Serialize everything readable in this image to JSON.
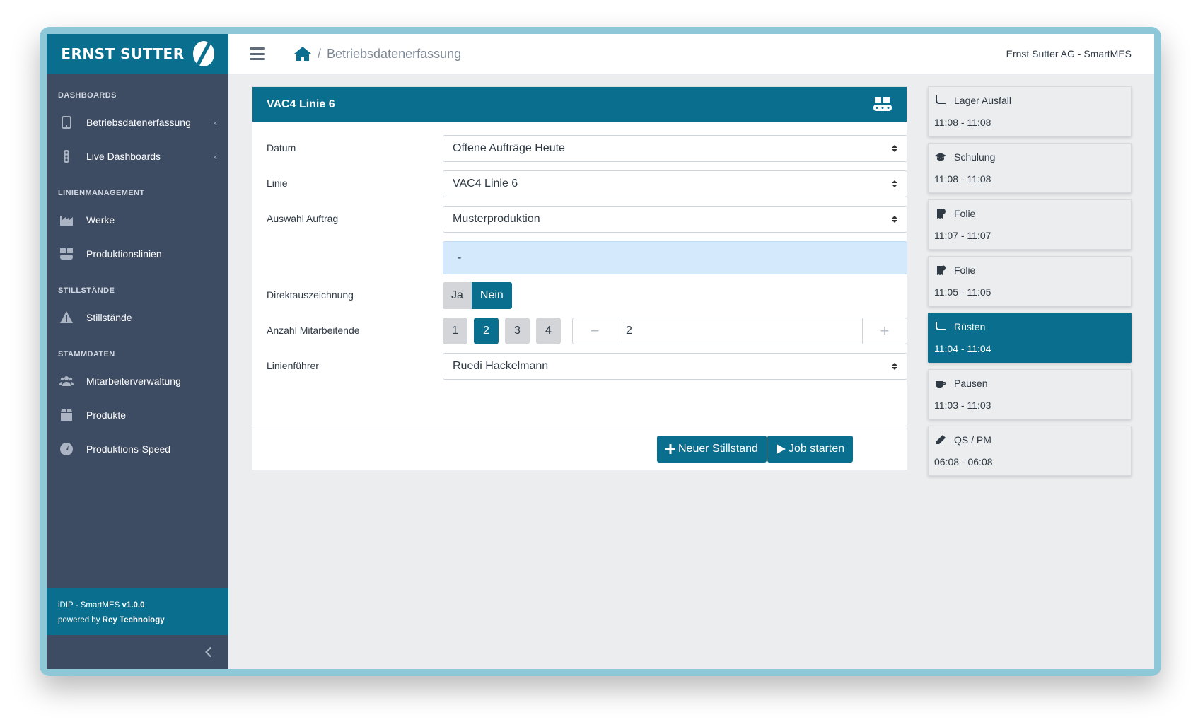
{
  "brand": {
    "name": "ERNST SUTTER"
  },
  "header": {
    "breadcrumb": "Betriebsdatenerfassung",
    "separator": "/",
    "company": "Ernst Sutter AG - SmartMES"
  },
  "sidebar": {
    "sections": [
      {
        "title": "DASHBOARDS",
        "items": [
          {
            "label": "Betriebsdatenerfassung",
            "icon": "tablet-icon",
            "caret": "‹"
          },
          {
            "label": "Live Dashboards",
            "icon": "traffic-light-icon",
            "caret": "‹"
          }
        ]
      },
      {
        "title": "LINIENMANAGEMENT",
        "items": [
          {
            "label": "Werke",
            "icon": "industry-icon"
          },
          {
            "label": "Produktionslinien",
            "icon": "conveyor-icon"
          }
        ]
      },
      {
        "title": "STILLSTÄNDE",
        "items": [
          {
            "label": "Stillstände",
            "icon": "warning-icon"
          }
        ]
      },
      {
        "title": "STAMMDATEN",
        "items": [
          {
            "label": "Mitarbeiterverwaltung",
            "icon": "users-icon"
          },
          {
            "label": "Produkte",
            "icon": "box-icon"
          },
          {
            "label": "Produktions-Speed",
            "icon": "speedometer-icon"
          }
        ]
      }
    ],
    "footer": {
      "app_prefix": "iDIP - SmartMES ",
      "version": "v1.0.0",
      "powered_prefix": "powered by ",
      "company": "Rey Technology"
    }
  },
  "card": {
    "title": "VAC4 Linie 6",
    "fields": {
      "datum_label": "Datum",
      "datum_value": "Offene Aufträge Heute",
      "linie_label": "Linie",
      "linie_value": "VAC4 Linie 6",
      "auftrag_label": "Auswahl Auftrag",
      "auftrag_value": "Musterproduktion",
      "info_text": "-",
      "direkt_label": "Direktauszeichnung",
      "direkt_yes": "Ja",
      "direkt_no": "Nein",
      "mitarbeiter_label": "Anzahl Mitarbeitende",
      "mitarbeiter_options": [
        "1",
        "2",
        "3",
        "4"
      ],
      "mitarbeiter_value": "2",
      "stepper_minus": "−",
      "stepper_plus": "+",
      "fuehrer_label": "Linienführer",
      "fuehrer_value": "Ruedi Hackelmann"
    },
    "buttons": {
      "neuer_stillstand": "Neuer Stillstand",
      "job_starten": "Job starten"
    }
  },
  "events": [
    {
      "title": "Lager Ausfall",
      "time": "11:08 - 11:08",
      "icon": "pipe-icon",
      "active": false
    },
    {
      "title": "Schulung",
      "time": "11:08 - 11:08",
      "icon": "graduation-cap-icon",
      "active": false
    },
    {
      "title": "Folie",
      "time": "11:07 - 11:07",
      "icon": "toilet-paper-icon",
      "active": false
    },
    {
      "title": "Folie",
      "time": "11:05 - 11:05",
      "icon": "toilet-paper-icon",
      "active": false
    },
    {
      "title": "Rüsten",
      "time": "11:04 - 11:04",
      "icon": "pipe-icon",
      "active": true
    },
    {
      "title": "Pausen",
      "time": "11:03 - 11:03",
      "icon": "coffee-icon",
      "active": false
    },
    {
      "title": "QS / PM",
      "time": "06:08 - 06:08",
      "icon": "pencil-icon",
      "active": false
    }
  ],
  "colors": {
    "accent": "#0a6f8e",
    "sidebar": "#3d4b63",
    "info": "#d4e9fb",
    "background": "#ecedef"
  }
}
